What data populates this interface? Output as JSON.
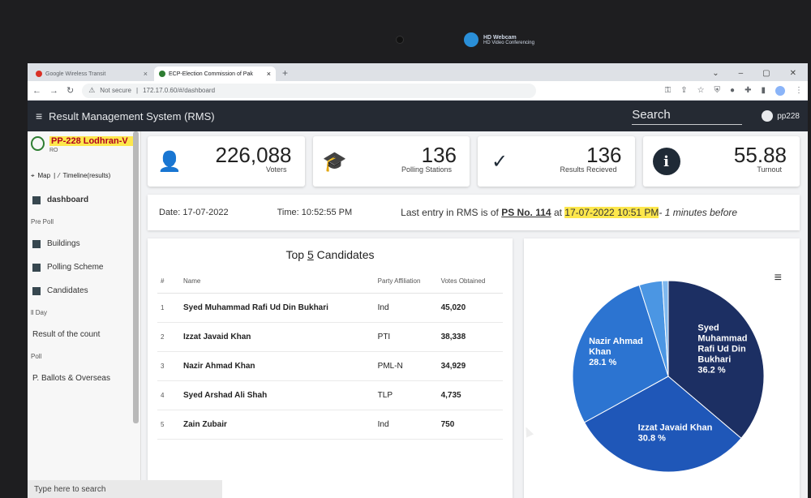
{
  "webcam": {
    "title": "HD Webcam",
    "subtitle": "HD Video Conferencing"
  },
  "browser": {
    "tabs": [
      {
        "label": "Google Wireless Transit",
        "active": false
      },
      {
        "label": "ECP-Election Commission of Pak",
        "active": true
      }
    ],
    "address": {
      "security": "Not secure",
      "url": "172.17.0.60/#/dashboard"
    }
  },
  "app": {
    "title": "Result Management System (RMS)",
    "search_placeholder": "Search",
    "user": "pp228"
  },
  "sidebar": {
    "constituency": "PP-228 Lodhran-V",
    "role": "RO",
    "link_map": "Map",
    "link_timeline": "Timeline(results)",
    "dashboard": "dashboard",
    "section_pre_poll": "Pre Poll",
    "buildings": "Buildings",
    "polling_scheme": "Polling Scheme",
    "candidates": "Candidates",
    "section_poll_day": "ll Day",
    "result_of_count": "Result of the count",
    "section_post_poll": "Poll",
    "ballots": "P. Ballots & Overseas"
  },
  "stats": [
    {
      "value": "226,088",
      "label": "Voters",
      "icon": "user-icon"
    },
    {
      "value": "136",
      "label": "Polling Stations",
      "icon": "graduation-cap-icon"
    },
    {
      "value": "136",
      "label": "Results Recieved",
      "icon": "check-icon"
    },
    {
      "value": "55.88",
      "label": "Turnout",
      "icon": "info-icon"
    }
  ],
  "info": {
    "date": "Date: 17-07-2022",
    "time": "Time: 10:52:55 PM",
    "last_prefix": "Last entry in RMS is of",
    "ps": "PS No. 114",
    "at": "at",
    "last_time": "17-07-2022 10:51 PM",
    "ago": "- 1 minutes before"
  },
  "table": {
    "title_pre": "Top ",
    "title_num": "5",
    "title_post": " Candidates",
    "headers": [
      "#",
      "Name",
      "Party Affiliation",
      "Votes Obtained"
    ],
    "rows": [
      {
        "n": "1",
        "name": "Syed Muhammad Rafi Ud Din Bukhari",
        "party": "Ind",
        "votes": "45,020"
      },
      {
        "n": "2",
        "name": "Izzat Javaid Khan",
        "party": "PTI",
        "votes": "38,338"
      },
      {
        "n": "3",
        "name": "Nazir Ahmad Khan",
        "party": "PML-N",
        "votes": "34,929"
      },
      {
        "n": "4",
        "name": "Syed Arshad Ali Shah",
        "party": "TLP",
        "votes": "4,735"
      },
      {
        "n": "5",
        "name": "Zain Zubair",
        "party": "Ind",
        "votes": "750"
      }
    ]
  },
  "chart_data": {
    "type": "pie",
    "slices": [
      {
        "name": "Syed Muhammad Rafi Ud Din Bukhari",
        "value": 36.2,
        "color": "#1c2f63"
      },
      {
        "name": "Izzat Javaid Khan",
        "value": 30.8,
        "color": "#1f57b8"
      },
      {
        "name": "Nazir Ahmad Khan",
        "value": 28.1,
        "color": "#2c74d1"
      },
      {
        "name": "Syed Arshad Ali Shah",
        "value": 3.9,
        "color": "#4b96e3"
      },
      {
        "name": "Zain Zubair",
        "value": 1.0,
        "color": "#7fb8ee"
      }
    ],
    "labels": [
      {
        "lines": [
          "Syed",
          "Muhammad",
          "Rafi Ud Din",
          "Bukhari",
          "36.2 %"
        ]
      },
      {
        "lines": [
          "Izzat Javaid Khan",
          "30.8 %"
        ]
      },
      {
        "lines": [
          "Nazir Ahmad",
          "Khan",
          "28.1 %"
        ]
      }
    ]
  },
  "taskbar": {
    "search": "Type here to search"
  }
}
